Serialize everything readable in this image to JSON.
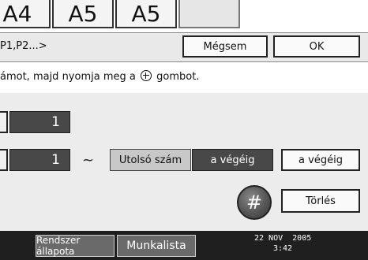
{
  "top_keys": [
    {
      "label": "A4"
    },
    {
      "label": "A5"
    },
    {
      "label": "A5"
    },
    {
      "label": ""
    }
  ],
  "header": {
    "title": "P1,P2...>",
    "cancel_label": "Mégsem",
    "ok_label": "OK"
  },
  "instruction": {
    "text_before": "ámot, majd nyomja meg a",
    "text_after": "gombot."
  },
  "fields": {
    "first_value": "1",
    "second_value": "1",
    "tilde": "~",
    "last_number_label": "Utolsó szám",
    "to_end_selected_label": "a végéig",
    "to_end_button_label": "a végéig",
    "hash_label": "#",
    "clear_label": "Törlés"
  },
  "taskbar": {
    "status_label": "Rendszer állapota",
    "jobs_label": "Munkalista",
    "date": "22 NOV  2005",
    "time": "3:42"
  }
}
